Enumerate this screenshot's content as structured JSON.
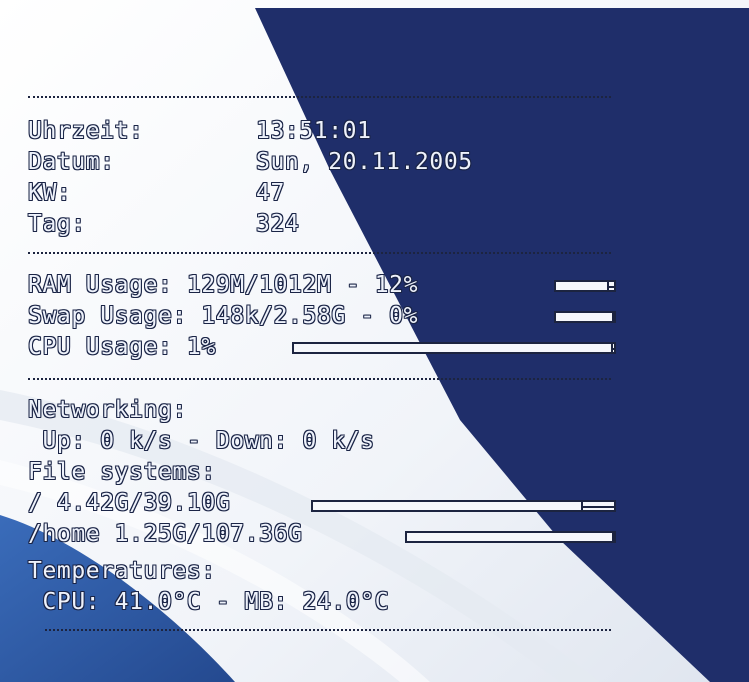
{
  "colors": {
    "background_white": "#ffffff",
    "background_navy": "#1f2e6a",
    "background_blue": "#2f5ca8",
    "text": "#eef2fb",
    "outline": "#1a2446"
  },
  "datetime": {
    "time_label": "Uhrzeit:",
    "time_value": "13:51:01",
    "date_label": "Datum:",
    "date_value": "Sun, 20.11.2005",
    "week_label": "KW:",
    "week_value": "47",
    "day_label": "Tag:",
    "day_value": "324"
  },
  "usage": {
    "ram_text": "RAM Usage: 129M/1012M - 12%",
    "ram_percent": 12,
    "swap_text": "Swap Usage: 148k/2.58G - 0%",
    "swap_percent": 0,
    "cpu_text": "CPU Usage: 1%",
    "cpu_percent": 1
  },
  "network": {
    "heading": "Networking:",
    "speeds": " Up: 0 k/s - Down: 0 k/s"
  },
  "filesystems": {
    "heading": "File systems:",
    "items": [
      {
        "label": "/ 4.42G/39.10G",
        "used_percent": 11
      },
      {
        "label": "/home 1.25G/107.36G",
        "used_percent": 1
      }
    ]
  },
  "temperatures": {
    "heading": "Temperatures:",
    "values": " CPU: 41.0°C - MB: 24.0°C"
  }
}
